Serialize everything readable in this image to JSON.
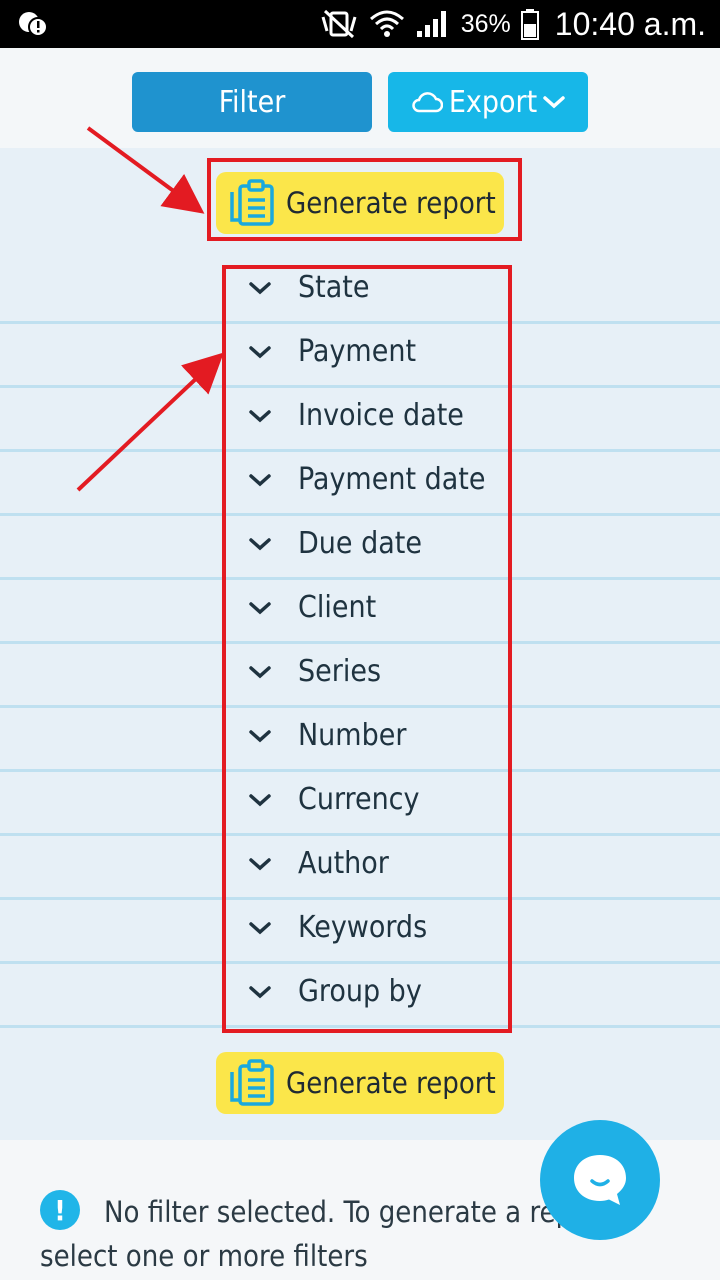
{
  "status": {
    "battery_pct": "36%",
    "time": "10:40 a.m."
  },
  "toolbar": {
    "filter_label": "Filter",
    "export_label": "Export"
  },
  "report": {
    "generate_label": "Generate report"
  },
  "filters": [
    {
      "label": "State"
    },
    {
      "label": "Payment"
    },
    {
      "label": "Invoice date"
    },
    {
      "label": "Payment date"
    },
    {
      "label": "Due date"
    },
    {
      "label": "Client"
    },
    {
      "label": "Series"
    },
    {
      "label": "Number"
    },
    {
      "label": "Currency"
    },
    {
      "label": "Author"
    },
    {
      "label": "Keywords"
    },
    {
      "label": "Group by"
    }
  ],
  "notice": {
    "text": "No filter selected. To generate a report select one or more filters"
  },
  "colors": {
    "filter_btn": "#1f93cf",
    "export_btn": "#17b7e8",
    "generate_btn": "#fbe64a",
    "highlight": "#e31b22"
  }
}
